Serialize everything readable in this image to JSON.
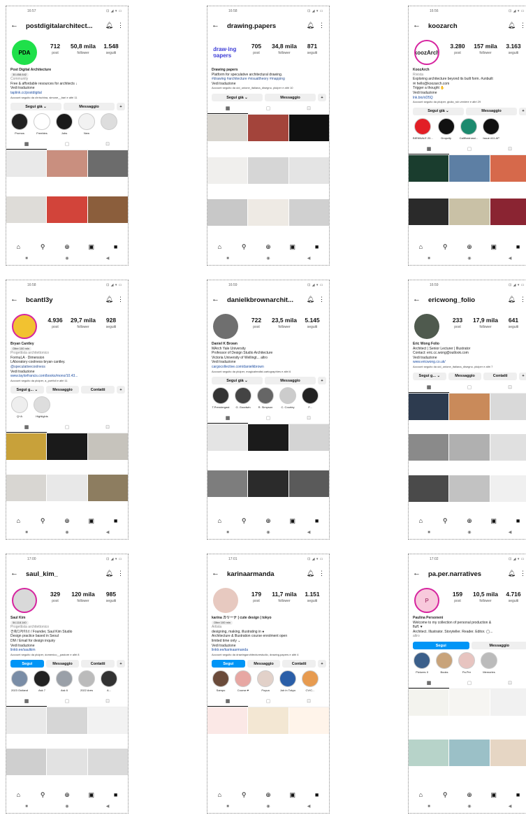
{
  "phones": [
    {
      "time": "16:57",
      "status_icons": "⊡ ◢ ▾ ▭",
      "username": "postdigitalarchitect...",
      "avatar_text": "PDA",
      "avatar_bg": "#1fe04a",
      "avatar_fg": "#000",
      "avatar_ring": false,
      "posts": "712",
      "followers": "50,8 mila",
      "following": "1.548",
      "bio": [
        {
          "t": "Post Digital Architecture",
          "c": "b"
        },
        {
          "t": "30.458.642",
          "c": "badge"
        },
        {
          "t": "Community",
          "c": "cat"
        },
        {
          "t": "Free & affordable resources for architects ↓",
          "c": ""
        },
        {
          "t": "Vedi traduzione",
          "c": ""
        },
        {
          "t": "taplink.cc/postdigital",
          "c": "link"
        },
        {
          "t": "Account seguito da chrischina, simone__bari e altri 11",
          "c": "small"
        }
      ],
      "buttons": [
        {
          "t": "Segui già ⌄",
          "p": false
        },
        {
          "t": "Messaggio",
          "p": false
        },
        {
          "t": "+",
          "p": false,
          "s": true
        }
      ],
      "highlights": [
        "Promos",
        "Freebies",
        "Jobs",
        "New",
        ""
      ],
      "hl_colors": [
        "#222",
        "#fff",
        "#1a1a1a",
        "#f2f2f2",
        "#ddd"
      ],
      "tiles": [
        "#e9e9e9",
        "#c98f7f",
        "#6c6c6c",
        "#dedcd8",
        "#d2443a",
        "#8b5e3c"
      ]
    },
    {
      "time": "16:58",
      "status_icons": "⊡ ◢ ▾ ▭",
      "username": "drawing.papers",
      "avatar_text": "draw·ing papers",
      "avatar_bg": "#fff",
      "avatar_fg": "#3a3ad6",
      "avatar_ring": false,
      "posts": "705",
      "followers": "34,8 mila",
      "following": "871",
      "bio": [
        {
          "t": "Drawing papers",
          "c": "b"
        },
        {
          "t": "Platform for speculative architectural drawing.",
          "c": ""
        },
        {
          "t": "#drawing #architecture #visualtheory #mapping",
          "c": "tag"
        },
        {
          "t": "Vedi traduzione",
          "c": ""
        },
        {
          "t": "Account seguito da uid_unione_italiana_disegno, plulper e altri 10",
          "c": "small"
        }
      ],
      "buttons": [
        {
          "t": "Segui già ⌄",
          "p": false
        },
        {
          "t": "Messaggio",
          "p": false
        },
        {
          "t": "+",
          "p": false,
          "s": true
        }
      ],
      "highlights": [],
      "hl_colors": [],
      "tiles": [
        "#d8d5cf",
        "#a3443b",
        "#111",
        "#f0efed",
        "#d6d6d6",
        "#e4e4e4",
        "#c8c8c8",
        "#eeeae4",
        "#d0d0d0"
      ]
    },
    {
      "time": "16:56",
      "status_icons": "⊡ ◢ ▾ ▭",
      "username": "koozarch",
      "avatar_text": "koozArch",
      "avatar_bg": "#fff",
      "avatar_fg": "#222",
      "avatar_ring": true,
      "posts": "3.280",
      "followers": "157 mila",
      "following": "3.163",
      "bio": [
        {
          "t": "KoozArch",
          "c": "b"
        },
        {
          "t": "Rivista",
          "c": "cat"
        },
        {
          "t": "Exploring architecture beyond its built form. #unbuilt",
          "c": ""
        },
        {
          "t": "✉ hello@koozarch.com",
          "c": ""
        },
        {
          "t": "Trigger a thought ✋",
          "c": ""
        },
        {
          "t": "Vedi traduzione",
          "c": ""
        },
        {
          "t": "lnk.bio/xD5Q",
          "c": "link"
        },
        {
          "t": "Account seguito da plulper, giulia_rub.veniere e altri 29",
          "c": "small"
        }
      ],
      "buttons": [
        {
          "t": "Segui già ⌄",
          "p": false
        },
        {
          "t": "Messaggio",
          "p": false
        },
        {
          "t": "+",
          "p": false,
          "s": true
        }
      ],
      "highlights": [
        "BIENNALE 20...",
        "Dropcity",
        "Calllfordrossi...",
        "Issue #11.AP"
      ],
      "hl_colors": [
        "#e21f26",
        "#111",
        "#1c8a6e",
        "#111"
      ],
      "tiles": [
        "#1a3d2e",
        "#5d7fa4",
        "#d6694b",
        "#2a2a2a",
        "#c9c1a6",
        "#8a2432"
      ]
    },
    {
      "time": "16:58",
      "status_icons": "⊡ ◢ ▾ ▭",
      "username": "bcantl3y",
      "avatar_text": "",
      "avatar_bg": "#f2c230",
      "avatar_fg": "#000",
      "avatar_ring": true,
      "posts": "4.936",
      "followers": "29,7 mila",
      "following": "928",
      "bio": [
        {
          "t": "Bryan Cantley",
          "c": "b"
        },
        {
          "t": "Oltre 100 mln",
          "c": "badge"
        },
        {
          "t": "Progettista architettonico",
          "c": "cat"
        },
        {
          "t": "FormuLA · Dimension",
          "c": ""
        },
        {
          "t": "LAboratory·coolness·bryan·cantley.",
          "c": ""
        },
        {
          "t": "@speculativecoolness",
          "c": "tag"
        },
        {
          "t": "Vedi traduzione",
          "c": ""
        },
        {
          "t": "www.taylorfrancis.com/books/mono/10.43...",
          "c": "link"
        },
        {
          "t": "Account seguito da plulper, a_portfoli e altri 11",
          "c": "small"
        }
      ],
      "buttons": [
        {
          "t": "Segui g... ⌄",
          "p": false
        },
        {
          "t": "Messaggio",
          "p": false
        },
        {
          "t": "Contatti",
          "p": false
        },
        {
          "t": "+",
          "p": false,
          "s": true
        }
      ],
      "highlights": [
        "Q+A",
        "Highlights"
      ],
      "hl_colors": [
        "#eee",
        "#ddd"
      ],
      "tiles": [
        "#c8a13a",
        "#1a1a1a",
        "#c6c3bc",
        "#d8d6d2",
        "#e8e8e8",
        "#8d7d60"
      ]
    },
    {
      "time": "16:59",
      "status_icons": "⊡ ◢ ▾ ▭",
      "username": "danielkbrownarchit...",
      "avatar_text": "",
      "avatar_bg": "#6f6f6f",
      "avatar_fg": "#fff",
      "avatar_ring": false,
      "posts": "722",
      "followers": "23,5 mila",
      "following": "5.145",
      "bio": [
        {
          "t": "Daniel K Brown",
          "c": "b"
        },
        {
          "t": "MArch Yale University",
          "c": ""
        },
        {
          "t": "Professor of Design Studio Architecture",
          "c": ""
        },
        {
          "t": "Victoria University of Wellingt... altro",
          "c": ""
        },
        {
          "t": "Vedi traduzione",
          "c": ""
        },
        {
          "t": "cargocollective.com/danielkbrown",
          "c": "link"
        },
        {
          "t": "Account seguito da plulper, magicalrealist.cartographies e altri 6",
          "c": "small"
        }
      ],
      "buttons": [
        {
          "t": "Segui già ⌄",
          "p": false
        },
        {
          "t": "Messaggio",
          "p": false
        },
        {
          "t": "+",
          "p": false,
          "s": true
        }
      ],
      "highlights": [
        "T.Prendergast",
        "G. Goodwin",
        "R. Simpson",
        "C. Courtey",
        "F..."
      ],
      "hl_colors": [
        "#333",
        "#444",
        "#666",
        "#ccc",
        "#222"
      ],
      "tiles": [
        "#e4e4e4",
        "#1b1b1b",
        "#d4d4d4",
        "#7d7d7d",
        "#2b2b2b",
        "#5a5a5a"
      ]
    },
    {
      "time": "16:59",
      "status_icons": "⊡ ◢ ▾ ▭",
      "username": "ericwong_folio",
      "avatar_text": "",
      "avatar_bg": "#4f5a4e",
      "avatar_fg": "#fff",
      "avatar_ring": false,
      "posts": "233",
      "followers": "17,9 mila",
      "following": "641",
      "bio": [
        {
          "t": "Eric Wong Folio",
          "c": "b"
        },
        {
          "t": "Architect | Senior Lecturer | Illustrator",
          "c": ""
        },
        {
          "t": "Contact: eric.cc.wong@outlook.com",
          "c": ""
        },
        {
          "t": "Vedi traduzione",
          "c": ""
        },
        {
          "t": "www.ericwong.co.uk/",
          "c": "link"
        },
        {
          "t": "Account seguito da uid_unione_italiana_disegno, plulper e altri 7",
          "c": "small"
        }
      ],
      "buttons": [
        {
          "t": "Segui g... ⌄",
          "p": false
        },
        {
          "t": "Messaggio",
          "p": false
        },
        {
          "t": "Contatti",
          "p": false
        },
        {
          "t": "+",
          "p": false,
          "s": true
        }
      ],
      "highlights": [],
      "hl_colors": [],
      "tiles": [
        "#2d3b4f",
        "#c98a5a",
        "#d9d9d9",
        "#8a8a8a",
        "#b0b0b0",
        "#e0e0e0",
        "#4a4a4a",
        "#c2c2c2",
        "#f0f0f0"
      ]
    },
    {
      "time": "17:00",
      "status_icons": "⊡ ◢ ▾ ▭",
      "username": "saul_kim_",
      "avatar_text": "",
      "avatar_bg": "#d9d9d9",
      "avatar_fg": "#000",
      "avatar_ring": true,
      "posts": "329",
      "followers": "120 mila",
      "following": "985",
      "bio": [
        {
          "t": "Saul Kim",
          "c": "b"
        },
        {
          "t": "54.118.140",
          "c": "badge"
        },
        {
          "t": "Progettista architettonico",
          "c": "cat"
        },
        {
          "t": "건축디자이너 / Founder, Saul Kim Studio",
          "c": ""
        },
        {
          "t": "Design practice based in Seoul",
          "c": ""
        },
        {
          "t": "DM / Email for design inquiry",
          "c": ""
        },
        {
          "t": "Vedi traduzione",
          "c": ""
        },
        {
          "t": "linktr.ee/saulkim",
          "c": "link"
        },
        {
          "t": "Account seguito da plulper, domenico__pastore e altri 8",
          "c": "small"
        }
      ],
      "buttons": [
        {
          "t": "Segui",
          "p": true
        },
        {
          "t": "Messaggio",
          "p": false
        },
        {
          "t": "Contatti",
          "p": false
        },
        {
          "t": "+",
          "p": false,
          "s": true
        }
      ],
      "highlights": [
        "2023 Outland",
        "Ask 7",
        "Ask 6",
        "2022 Ares",
        "A..."
      ],
      "hl_colors": [
        "#7a8da6",
        "#222",
        "#9aa0a8",
        "#bbb",
        "#333"
      ],
      "tiles": [
        "#e9e9e9",
        "#d6d6d6",
        "#f2f2f2",
        "#cfcfcf",
        "#e2e2e2",
        "#dadada"
      ]
    },
    {
      "time": "17:01",
      "status_icons": "⊡ ◢ ▾ ▭",
      "username": "karinaarmanda",
      "avatar_text": "",
      "avatar_bg": "#e7c9c0",
      "avatar_fg": "#000",
      "avatar_ring": false,
      "posts": "179",
      "followers": "11,7 mila",
      "following": "1.151",
      "bio": [
        {
          "t": "karina カリーナ | cute design | tokyo",
          "c": "b"
        },
        {
          "t": "Oltre 100 mln",
          "c": "badge"
        },
        {
          "t": "Artista",
          "c": "cat"
        },
        {
          "t": "designing, making, illustrating in ●",
          "c": ""
        },
        {
          "t": "Architecture & Illustration course enrolment open",
          "c": ""
        },
        {
          "t": "limited time only ⌄",
          "c": ""
        },
        {
          "t": "Vedi traduzione",
          "c": ""
        },
        {
          "t": "linktr.ee/karinaarmanda",
          "c": "link"
        },
        {
          "t": "Account seguito da drawingarchitecturestudio, drawing.papers e altri 4",
          "c": "small"
        }
      ],
      "buttons": [
        {
          "t": "Segui",
          "p": true
        },
        {
          "t": "Messaggio",
          "p": false
        },
        {
          "t": "Contatti",
          "p": false
        },
        {
          "t": "+",
          "p": false,
          "s": true
        }
      ],
      "highlights": [
        "Sampo",
        "Course ♥",
        "Poyua",
        "Job in Tokyo",
        "CV/C..."
      ],
      "hl_colors": [
        "#6b4b3a",
        "#e7a7a3",
        "#e2d1c9",
        "#2b5fa8",
        "#e79b50"
      ],
      "tiles": [
        "#fbe8e6",
        "#f3e7d3",
        "#fff4ea"
      ]
    },
    {
      "time": "17:02",
      "status_icons": "⊡ ◢ ▾ ▭",
      "username": "pa.per.narratives",
      "avatar_text": "P",
      "avatar_bg": "#f8c9dc",
      "avatar_fg": "#b04a7a",
      "avatar_ring": true,
      "posts": "159",
      "followers": "10,5 mila",
      "following": "4.716",
      "bio": [
        {
          "t": "Paulina Personeni",
          "c": "b"
        },
        {
          "t": "Welcome to my collection of personal production &",
          "c": ""
        },
        {
          "t": "fluff. ♥",
          "c": ""
        },
        {
          "t": "Architect. Illustrator. Storyteller. Reader. Editor. ◯...",
          "c": ""
        },
        {
          "t": "altro",
          "c": "cat"
        }
      ],
      "buttons": [
        {
          "t": "Segui",
          "p": true
        },
        {
          "t": "Messaggio",
          "p": false
        }
      ],
      "highlights": [
        "Pictures II",
        "Books",
        "Pa.Per",
        "Memories"
      ],
      "hl_colors": [
        "#3b5f8a",
        "#c8a37a",
        "#e7c4c0",
        "#bbb"
      ],
      "tiles": [
        "#f3f3ee",
        "#f6f5f2",
        "#f1f1f1",
        "#b7d3c9",
        "#9bc0c7",
        "#e6d6c4"
      ]
    }
  ],
  "nav_icons": {
    "home": "⌂",
    "search": "⚲",
    "add": "⊕",
    "reels": "▣",
    "profile": "■"
  },
  "sys_icons": {
    "square": "■",
    "circle": "◉",
    "back": "◀"
  },
  "tab_icons": {
    "grid": "▦",
    "reels": "▢",
    "tagged": "⊡"
  }
}
